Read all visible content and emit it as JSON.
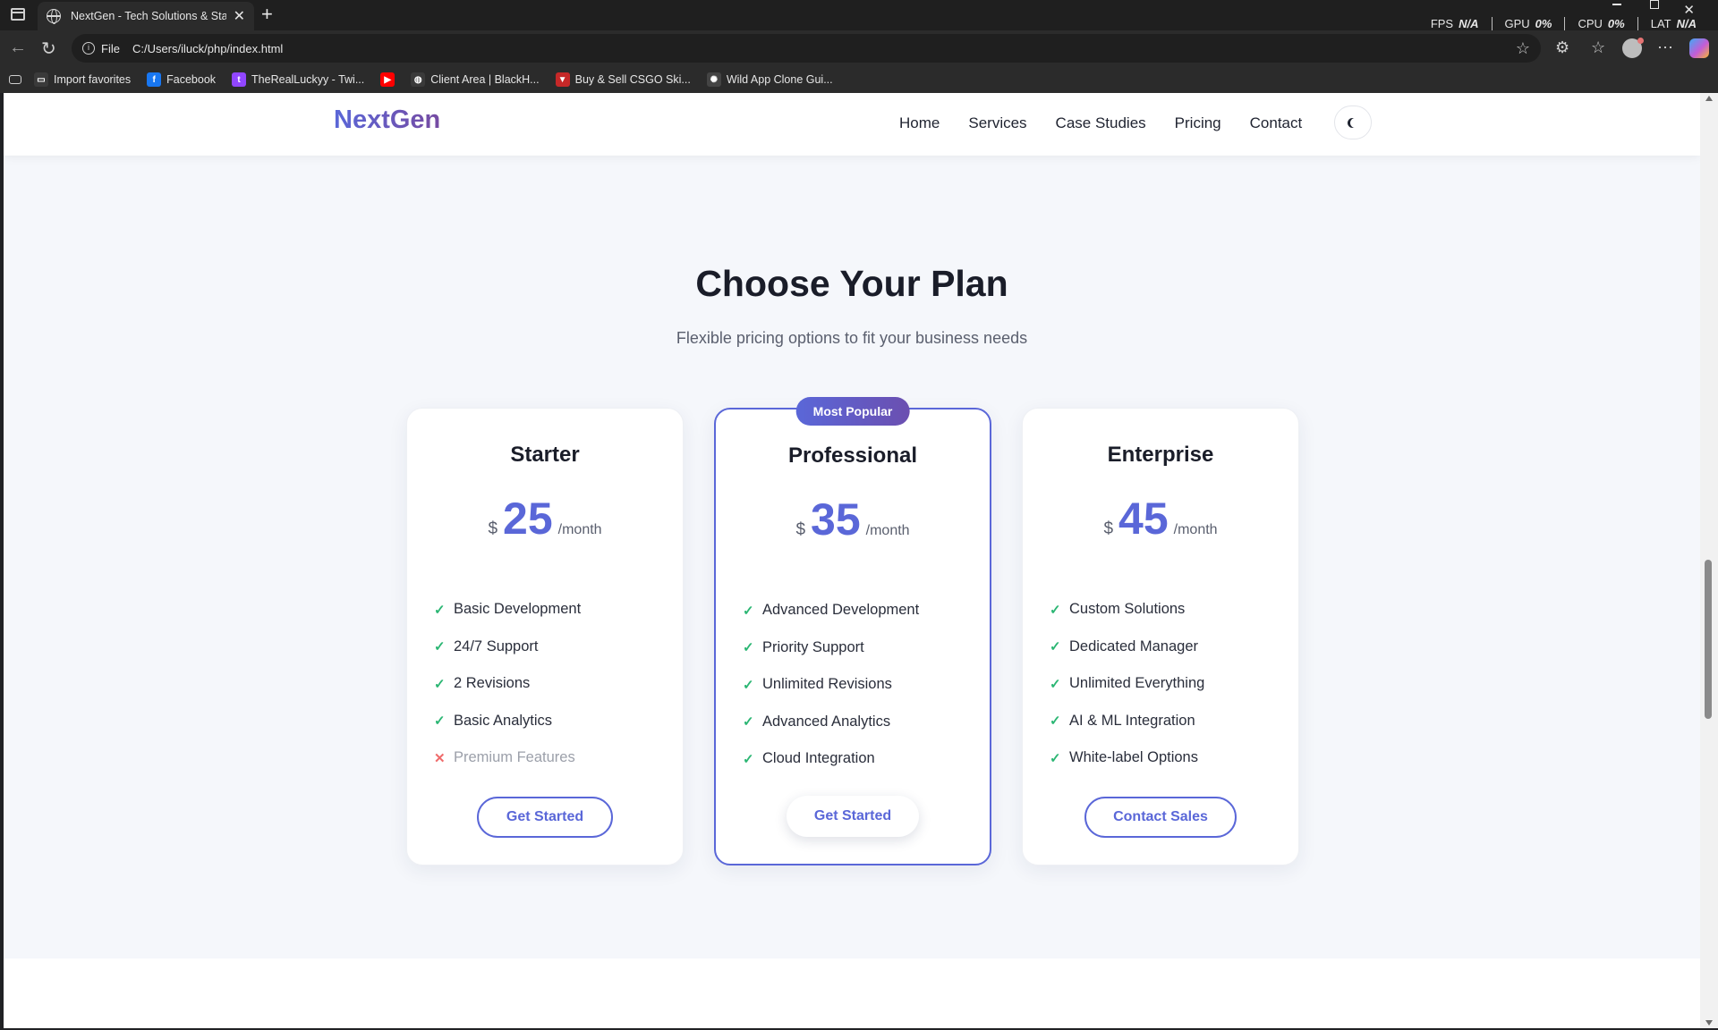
{
  "browser": {
    "tab_title": "NextGen - Tech Solutions & Startups",
    "tab_close": "✕",
    "new_tab": "+",
    "perf": [
      {
        "label": "FPS",
        "value": "N/A"
      },
      {
        "label": "GPU",
        "value": "0%"
      },
      {
        "label": "CPU",
        "value": "0%"
      },
      {
        "label": "LAT",
        "value": "N/A"
      }
    ],
    "address_prefix": "File",
    "address": "C:/Users/iluck/php/index.html",
    "favorites": [
      {
        "label": "Import favorites",
        "icon": "folder-icon",
        "color": "#3a3a3a",
        "glyph": "▭"
      },
      {
        "label": "Facebook",
        "icon": "facebook-icon",
        "color": "#1877f2",
        "glyph": "f"
      },
      {
        "label": "TheRealLuckyy - Twi...",
        "icon": "twitch-icon",
        "color": "#9146ff",
        "glyph": "t"
      },
      {
        "label": "",
        "icon": "youtube-icon",
        "color": "#ff0000",
        "glyph": "▶"
      },
      {
        "label": "Client Area | BlackH...",
        "icon": "globe-icon",
        "color": "#3a3a3a",
        "glyph": "◍"
      },
      {
        "label": "Buy & Sell CSGO Ski...",
        "icon": "skin-shop-icon",
        "color": "#c62828",
        "glyph": "▼"
      },
      {
        "label": "Wild App Clone Gui...",
        "icon": "openai-icon",
        "color": "#444444",
        "glyph": "✺"
      }
    ]
  },
  "site": {
    "logo": "NextGen",
    "nav": [
      "Home",
      "Services",
      "Case Studies",
      "Pricing",
      "Contact"
    ],
    "accent": "#5a67d8"
  },
  "pricing": {
    "title": "Choose Your Plan",
    "subtitle": "Flexible pricing options to fit your business needs",
    "plans": [
      {
        "name": "Starter",
        "currency": "$",
        "amount": "25",
        "period": "/month",
        "features": [
          {
            "text": "Basic Development",
            "included": true
          },
          {
            "text": "24/7 Support",
            "included": true
          },
          {
            "text": "2 Revisions",
            "included": true
          },
          {
            "text": "Basic Analytics",
            "included": true
          },
          {
            "text": "Premium Features",
            "included": false
          }
        ],
        "cta": "Get Started"
      },
      {
        "name": "Professional",
        "badge": "Most Popular",
        "currency": "$",
        "amount": "35",
        "period": "/month",
        "features": [
          {
            "text": "Advanced Development",
            "included": true
          },
          {
            "text": "Priority Support",
            "included": true
          },
          {
            "text": "Unlimited Revisions",
            "included": true
          },
          {
            "text": "Advanced Analytics",
            "included": true
          },
          {
            "text": "Cloud Integration",
            "included": true
          }
        ],
        "cta": "Get Started"
      },
      {
        "name": "Enterprise",
        "currency": "$",
        "amount": "45",
        "period": "/month",
        "features": [
          {
            "text": "Custom Solutions",
            "included": true
          },
          {
            "text": "Dedicated Manager",
            "included": true
          },
          {
            "text": "Unlimited Everything",
            "included": true
          },
          {
            "text": "AI & ML Integration",
            "included": true
          },
          {
            "text": "White-label Options",
            "included": true
          }
        ],
        "cta": "Contact Sales"
      }
    ]
  }
}
